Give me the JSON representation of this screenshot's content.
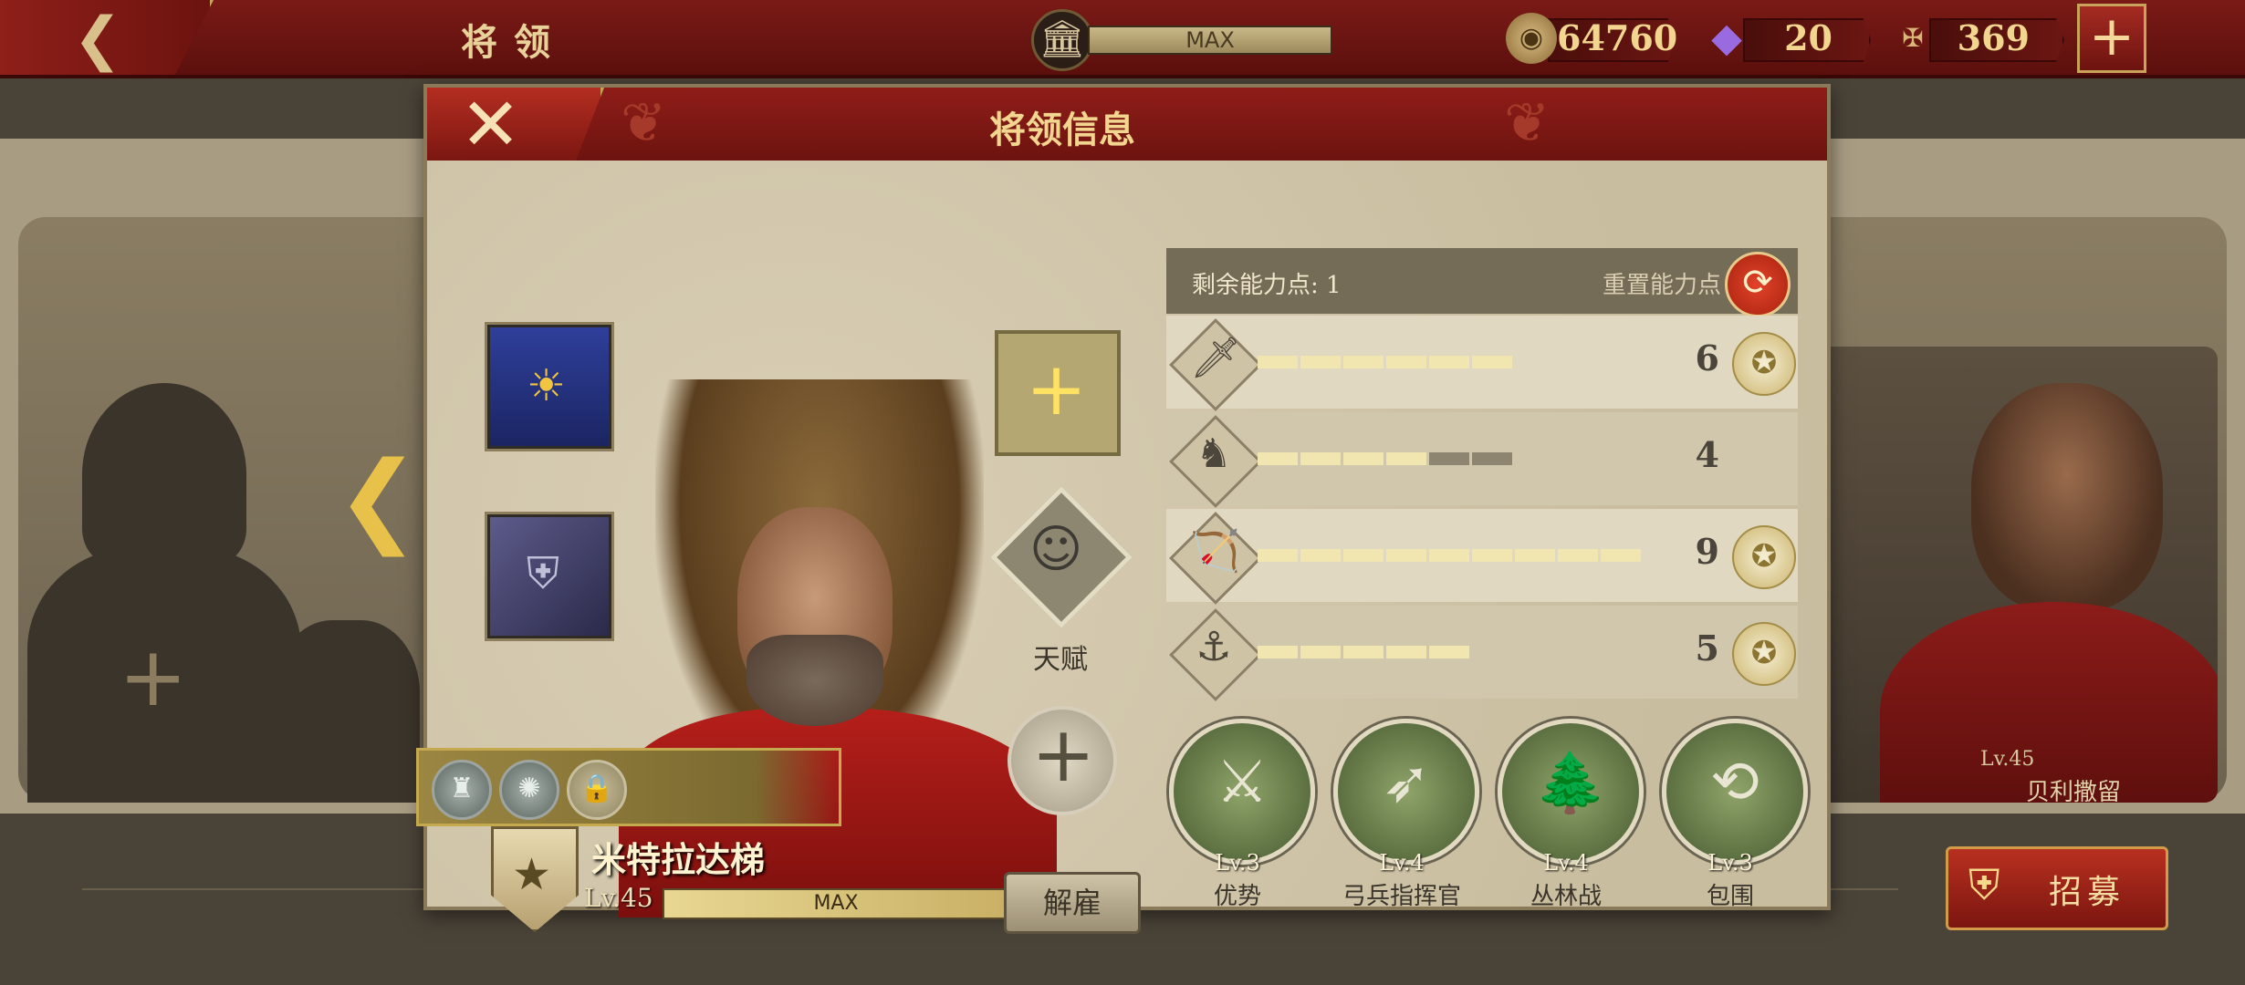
{
  "topbar": {
    "title": "将领",
    "max_label": "MAX",
    "resources": [
      {
        "name": "coin-icon",
        "value": "64760",
        "color": "#c9a86a"
      },
      {
        "name": "gem-icon",
        "value": "20",
        "color": "#8a5ad0"
      },
      {
        "name": "spqr-icon",
        "value": "369",
        "color": "#c9a86a"
      }
    ]
  },
  "dialog": {
    "title": "将领信息",
    "talent_label": "天赋",
    "hero": {
      "name": "米特拉达梯",
      "level": "Lv.45",
      "xp_label": "MAX"
    },
    "dismiss_label": "解雇",
    "stats": {
      "points_label": "剩余能力点: 1",
      "reset_label": "重置能力点",
      "rows": [
        {
          "icon": "sword-icon",
          "glyph": "🗡",
          "value": "6",
          "filled": 6,
          "total": 6,
          "medal": true
        },
        {
          "icon": "horse-icon",
          "glyph": "♞",
          "value": "4",
          "filled": 4,
          "total": 6,
          "medal": false
        },
        {
          "icon": "bow-icon",
          "glyph": "🏹",
          "value": "9",
          "filled": 9,
          "total": 9,
          "medal": true
        },
        {
          "icon": "anchor-icon",
          "glyph": "⚓",
          "value": "5",
          "filled": 5,
          "total": 5,
          "medal": true
        }
      ]
    },
    "skills": [
      {
        "level": "Lv.3",
        "name": "优势",
        "icon": "archers-icon",
        "glyph": "⚔"
      },
      {
        "level": "Lv.4",
        "name": "弓兵指挥官",
        "icon": "bow-commander-icon",
        "glyph": "➶"
      },
      {
        "level": "Lv.4",
        "name": "丛林战",
        "icon": "forest-icon",
        "glyph": "🌲"
      },
      {
        "level": "Lv.3",
        "name": "包围",
        "icon": "encircle-icon",
        "glyph": "⟲"
      }
    ]
  },
  "background": {
    "right_card_level": "Lv.45",
    "right_card_name": "贝利撒留"
  },
  "recruit_label": "招募"
}
